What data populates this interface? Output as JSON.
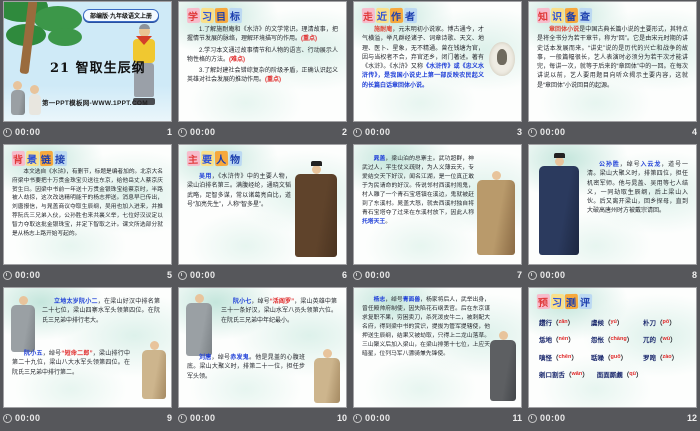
{
  "colors": {
    "page_bg": "#56575b",
    "accent_red": "#e02a2a",
    "accent_blue": "#1f3fd8",
    "title_blue": "#1d3fae",
    "caption_text": "#e9e9e9"
  },
  "grid": {
    "duration": "00:00"
  },
  "s1": {
    "number": "1",
    "banner": "部编版·九年级语文上册",
    "lesson_title": "21 智取生辰纲",
    "site": "第一PPT模板网-WWW.1PPT.COM"
  },
  "s2": {
    "number": "2",
    "title": "学习目标",
    "items": [
      {
        "text": "1.了解施耐庵和《水浒》的文学常识。理清故事，把握情节发展的脉络，理解环境描写的作用。",
        "tag": "(重点)"
      },
      {
        "text": "2.学习本文通过故事情节和人物的语言、行动展示人物性格的方法。",
        "tag": "(难点)"
      },
      {
        "text": "3.了解封建社会错综复杂的阶级矛盾，正确认识起义英雄对社会发展的推动作用。",
        "tag": "(重点)"
      }
    ]
  },
  "s3": {
    "number": "3",
    "title": "走近作者",
    "name": "施耐庵",
    "body": "，元末明初小说家。博古通今，才气横溢，举凡群经诸子、词章诗歌、天文、地理、医卜、星象，无不精通。曾在钱塘为官，因与当权者不合，弃官还乡，闭门著述。著有《水浒》。《水浒》又称",
    "blue": "《水浒传》或《忠义水浒传》，是我国小说史上第一部反映农民起义的长篇白话章回体小说。"
  },
  "s4": {
    "number": "4",
    "title": "知识备查",
    "lead": "章回体小说",
    "body": "是中国古典长篇小说的主要形式，其特点是将全书分为若干章节，称为“回”。它是由宋元时期的讲史话本发展而来。“讲史”说的是历代的兴亡和战争的故事，一般篇幅很长，艺人表演时必须分为若干次才能讲完，每讲一次，就等于后来的“章回体”中的一回。在每次讲说以前，艺人要用题目向听众揭示主要内容，这就是“章回体”小说回目的起源。"
  },
  "s5": {
    "number": "5",
    "title": "背景链接",
    "body": "本文选自《水浒》，有删节，标题是编者加的。北京大名府梁中书要把十万贯金珠宝贝送往东京，给他岳丈人蔡京庆贺生日。因梁中书前一年送十万贯金银珠宝给蔡京时，半路被人劫掠，这次改选精明能干的杨志押送。消息早已传出，刘唐报信，与晁盖商议夺取生辰纲，吴用也加入进来，并推荐阮氏三兄弟入伙，公孙胜也来共襄义举，七位好汉议定以智力夺取这批金银珠宝，并定下智取之计。课文所选部分就是从杨志上路开始写起的。"
  },
  "s6": {
    "number": "6",
    "title": "主要人物",
    "name": "吴用",
    "body": "，《水浒传》中的主要人物，梁山泊排名第三。满腹经纶，通晓文韬武略，足智多谋，常以诸葛亮自比，道号“加亮先生”，人称“智多星”。"
  },
  "s7": {
    "number": "7",
    "name": "晁盖",
    "body": "，梁山泊的总寨主。武功超群，神武过人，平生仗义疏财，为人义薄云天，专爱结交天下好汉，闻名江湖，是一位真正敢于为民请命的好汉。传说邻村西溪村闹鬼，村人雕了一个青石宝塔镇在溪边，鬼就被赶到了东溪村。晁盖大怒，就去西溪村独自将青石宝塔夺了过来在东溪村放下，因此人称",
    "alias": "托塔天王",
    "end": "。"
  },
  "s8": {
    "number": "8",
    "name": "公孙胜",
    "mid": "，绰号",
    "alias": "入云龙",
    "body": "，道号一清。梁山大聚义时，排第四位，担任机密军师。他与晁盖、吴用等七人结义，一同劫取生辰纲，后上梁山入伙。后又离开梁山，回乡探母，直到大破高唐州时方被戴宗请回。"
  },
  "s9": {
    "number": "9",
    "p1_name": "立地太岁阮小二",
    "p1_body": "，在梁山好汉中排名第二十七位，梁山四寨水军头领第四位。在阮氏三兄弟中排行老大。",
    "p2_name": "阮小五",
    "p2_mid": "，绰号",
    "p2_alias": "“短命二郎”",
    "p2_body": "，梁山排行中第二十九位，梁山八大水军头领第四位。在阮氏三兄弟中排行第二。"
  },
  "s10": {
    "number": "10",
    "p1_name": "阮小七",
    "p1_mid": "，绰号",
    "p1_alias": "“活阎罗”",
    "p1_body": "，梁山英雄中第三十一条好汉，梁山水军八员头领第六位。在阮氏三兄弟中年纪最小。",
    "p2_name": "刘唐",
    "p2_mid": "，绰号",
    "p2_alias": "赤发鬼",
    "p2_body": "。他是晁盖的心腹班底。梁山大聚义时，排第二十一位，担任步军头领。"
  },
  "s11": {
    "number": "11",
    "name": "杨志",
    "mid": "，绰号",
    "alias": "青面兽",
    "body": "，杨家将后人，武举出身，曾任殿帅府制使，因失陷花石纲丢官。后在东京谋求复职不果，穷困卖刀，杀死泼皮牛二，被刺配大名府，得到梁中书的赏识，提拔为管军提辖使，他押送生辰纲，结果又被劫取，只得上二龙山落草。三山聚义后加入梁山，在梁山排第十七位，上应天暗星，位列马军八骠骑兼先锋使。"
  },
  "s12": {
    "number": "12",
    "title": "预习测评",
    "items": [
      {
        "w": "趱行",
        "py": "zǎn"
      },
      {
        "w": "虞候",
        "py": "yú"
      },
      {
        "w": "朴刀",
        "py": "pō"
      },
      {
        "w": "恁地",
        "py": "nèn"
      },
      {
        "w": "怨怅",
        "py": "chàng"
      },
      {
        "w": "兀的",
        "py": "wù"
      },
      {
        "w": "嗔怪",
        "py": "chēn"
      },
      {
        "w": "聒噪",
        "py": "guō"
      },
      {
        "w": "罗唣",
        "py": "zào"
      },
      {
        "w": "剜口割舌",
        "py": "wān"
      },
      {
        "w": "面面厮觑",
        "py": "qù"
      }
    ]
  }
}
